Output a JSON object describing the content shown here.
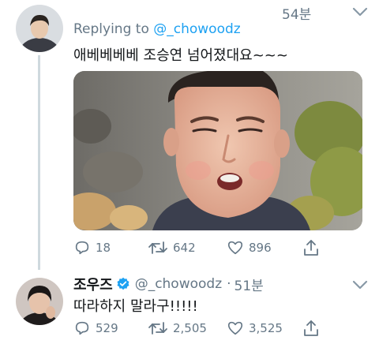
{
  "parent_tweet": {
    "avatar_alt": "profile photo",
    "reply_prefix": "Replying to",
    "reply_handle": "@_chowoodz",
    "timestamp": "54분",
    "text": "애베베베베 조승연 넘어졌대요~~~",
    "media_icon": "image-photo",
    "stats": {
      "replies": "18",
      "retweets": "642",
      "likes": "896"
    }
  },
  "reply_tweet": {
    "display_name": "조우즈",
    "handle": "@_chowoodz",
    "separator": "·",
    "timestamp": "51분",
    "text": "따라하지 말라구!!!!!",
    "stats": {
      "replies": "529",
      "retweets": "2,505",
      "likes": "3,525"
    }
  },
  "colors": {
    "accent": "#1da1f2",
    "secondary_text": "#657786",
    "thread_line": "#cfd9de"
  },
  "icons": [
    "reply-icon",
    "retweet-icon",
    "like-icon",
    "share-icon",
    "chevron-down-icon",
    "verified-badge-icon"
  ]
}
